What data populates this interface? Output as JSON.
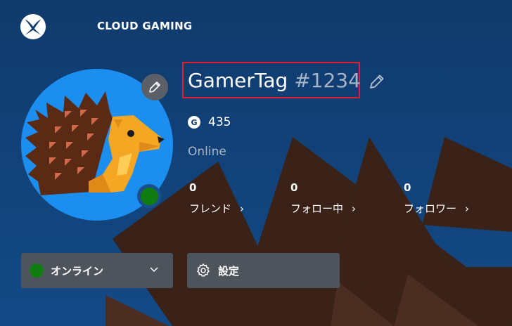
{
  "topbar": {
    "app_name": "CLOUD GAMING",
    "logo_icon": "xbox-logo-icon"
  },
  "profile": {
    "gamertag_name": "GamerTag",
    "gamertag_suffix": "#1234",
    "gamerscore_badge": "G",
    "gamerscore": "435",
    "presence": "Online",
    "avatar": "hedgehog-avatar",
    "status_color": "#107c10",
    "highlight_color": "#e0202e"
  },
  "stats": [
    {
      "count": "0",
      "label": "フレンド"
    },
    {
      "count": "0",
      "label": "フォロー中"
    },
    {
      "count": "0",
      "label": "フォロワー"
    }
  ],
  "buttons": {
    "online_label": "オンライン",
    "settings_label": "設定"
  },
  "icons": {
    "edit": "pencil-icon",
    "chevron": "chevron-right-icon",
    "dropdown": "chevron-down-icon",
    "settings": "gear-icon"
  }
}
